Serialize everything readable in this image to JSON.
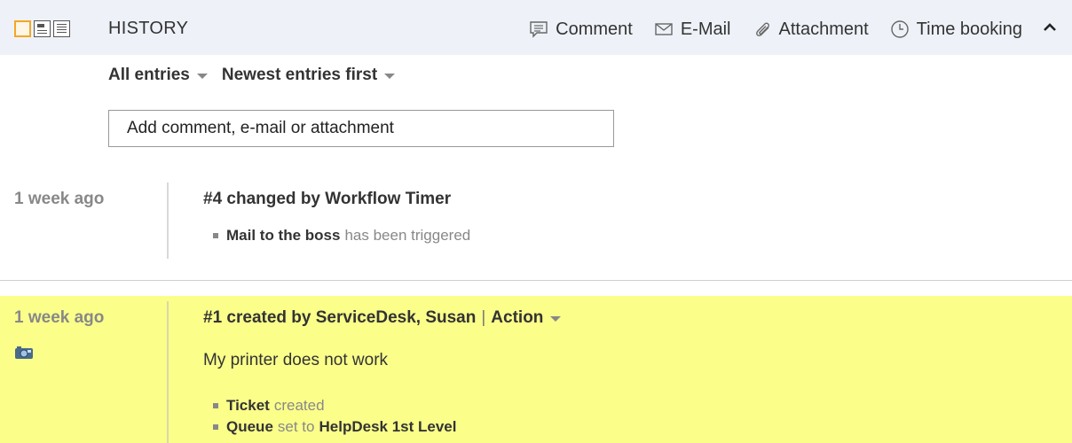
{
  "header": {
    "title": "HISTORY",
    "actions": [
      {
        "label": "Comment",
        "icon": "comment-icon"
      },
      {
        "label": "E-Mail",
        "icon": "mail-icon"
      },
      {
        "label": "Attachment",
        "icon": "paperclip-icon"
      },
      {
        "label": "Time booking",
        "icon": "clock-icon"
      }
    ],
    "collapse_icon": "chevron-up-icon"
  },
  "filters": {
    "entries": "All entries",
    "order": "Newest entries first"
  },
  "composer": {
    "placeholder": "Add comment, e-mail or attachment"
  },
  "entries": [
    {
      "time": "1 week ago",
      "title": "#4 changed by Workflow Timer",
      "items": [
        {
          "bold": "Mail to the boss",
          "text": "has been triggered",
          "bold_tail": ""
        }
      ]
    },
    {
      "time": "1 week ago",
      "title": "#1 created by ServiceDesk, Susan",
      "separator": "|",
      "action_label": "Action",
      "icon": "camera-icon",
      "body": "My printer does not work",
      "items": [
        {
          "bold": "Ticket",
          "text": "created",
          "bold_tail": ""
        },
        {
          "bold": "Queue",
          "text": "set to",
          "bold_tail": "HelpDesk 1st Level"
        }
      ],
      "highlight_color": "#fbff8a"
    }
  ],
  "colors": {
    "header_bg": "#eef2f8",
    "active_view": "#f5a623",
    "muted_text": "#888888"
  }
}
